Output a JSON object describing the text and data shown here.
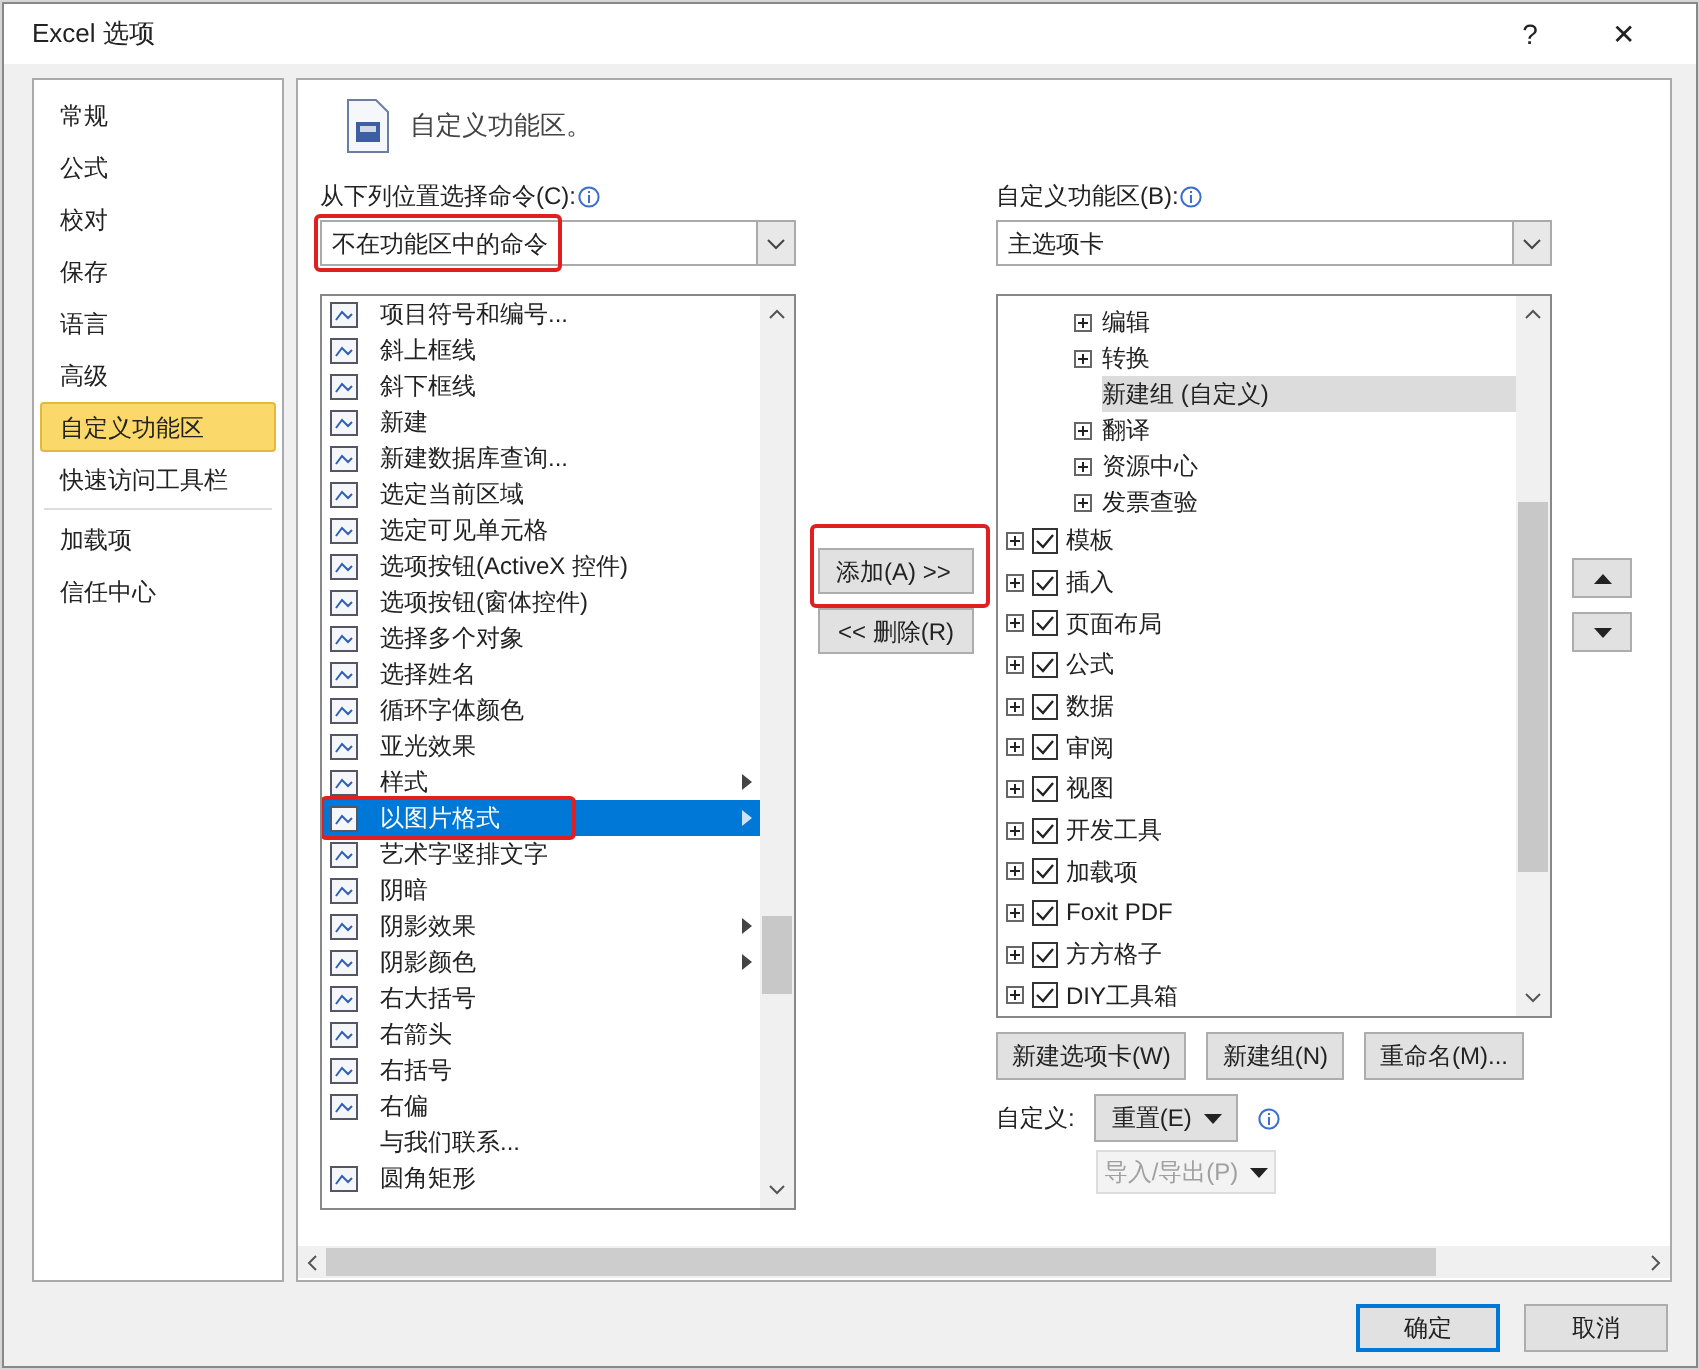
{
  "window": {
    "title": "Excel 选项",
    "help": "?",
    "close": "✕"
  },
  "sidebar": {
    "items": [
      {
        "label": "常规",
        "selected": false
      },
      {
        "label": "公式",
        "selected": false
      },
      {
        "label": "校对",
        "selected": false
      },
      {
        "label": "保存",
        "selected": false
      },
      {
        "label": "语言",
        "selected": false
      },
      {
        "label": "高级",
        "selected": false
      },
      {
        "label": "自定义功能区",
        "selected": true
      },
      {
        "label": "快速访问工具栏",
        "selected": false,
        "divider_after": true
      },
      {
        "label": "加载项",
        "selected": false
      },
      {
        "label": "信任中心",
        "selected": false
      }
    ]
  },
  "header": "自定义功能区。",
  "commands_source": {
    "label": "从下列位置选择命令(C):",
    "value": "不在功能区中的命令",
    "highlighted": true
  },
  "ribbon_target": {
    "label": "自定义功能区(B):",
    "value": "主选项卡"
  },
  "commands": [
    {
      "label": "项目符号和编号...",
      "has_icon": true,
      "submenu": false,
      "selected": false,
      "highlighted": false
    },
    {
      "label": "斜上框线",
      "has_icon": true,
      "submenu": false,
      "selected": false,
      "highlighted": false
    },
    {
      "label": "斜下框线",
      "has_icon": true,
      "submenu": false,
      "selected": false,
      "highlighted": false
    },
    {
      "label": "新建",
      "has_icon": true,
      "submenu": false,
      "selected": false,
      "highlighted": false
    },
    {
      "label": "新建数据库查询...",
      "has_icon": true,
      "submenu": false,
      "selected": false,
      "highlighted": false
    },
    {
      "label": "选定当前区域",
      "has_icon": true,
      "submenu": false,
      "selected": false,
      "highlighted": false
    },
    {
      "label": "选定可见单元格",
      "has_icon": true,
      "submenu": false,
      "selected": false,
      "highlighted": false
    },
    {
      "label": "选项按钮(ActiveX 控件)",
      "has_icon": true,
      "submenu": false,
      "selected": false,
      "highlighted": false
    },
    {
      "label": "选项按钮(窗体控件)",
      "has_icon": true,
      "submenu": false,
      "selected": false,
      "highlighted": false
    },
    {
      "label": "选择多个对象",
      "has_icon": true,
      "submenu": false,
      "selected": false,
      "highlighted": false
    },
    {
      "label": "选择姓名",
      "has_icon": true,
      "submenu": false,
      "selected": false,
      "highlighted": false
    },
    {
      "label": "循环字体颜色",
      "has_icon": true,
      "submenu": false,
      "selected": false,
      "highlighted": false
    },
    {
      "label": "亚光效果",
      "has_icon": true,
      "submenu": false,
      "selected": false,
      "highlighted": false
    },
    {
      "label": "样式",
      "has_icon": true,
      "submenu": true,
      "selected": false,
      "highlighted": false
    },
    {
      "label": "以图片格式",
      "has_icon": true,
      "submenu": true,
      "selected": true,
      "highlighted": true
    },
    {
      "label": "艺术字竖排文字",
      "has_icon": true,
      "submenu": false,
      "selected": false,
      "highlighted": false
    },
    {
      "label": "阴暗",
      "has_icon": true,
      "submenu": false,
      "selected": false,
      "highlighted": false
    },
    {
      "label": "阴影效果",
      "has_icon": true,
      "submenu": true,
      "selected": false,
      "highlighted": false
    },
    {
      "label": "阴影颜色",
      "has_icon": true,
      "submenu": true,
      "selected": false,
      "highlighted": false
    },
    {
      "label": "右大括号",
      "has_icon": true,
      "submenu": false,
      "selected": false,
      "highlighted": false
    },
    {
      "label": "右箭头",
      "has_icon": true,
      "submenu": false,
      "selected": false,
      "highlighted": false
    },
    {
      "label": "右括号",
      "has_icon": true,
      "submenu": false,
      "selected": false,
      "highlighted": false
    },
    {
      "label": "右偏",
      "has_icon": true,
      "submenu": false,
      "selected": false,
      "highlighted": false
    },
    {
      "label": "与我们联系...",
      "has_icon": false,
      "submenu": false,
      "selected": false,
      "highlighted": false
    },
    {
      "label": "圆角矩形",
      "has_icon": true,
      "submenu": false,
      "selected": false,
      "highlighted": false
    }
  ],
  "add_button": {
    "label": "添加(A) >>",
    "highlighted": true
  },
  "remove_button": {
    "label": "<< 删除(R)"
  },
  "tree": [
    {
      "label": "编辑",
      "kind": "group",
      "expanded": false,
      "selected": false
    },
    {
      "label": "转换",
      "kind": "group",
      "expanded": false,
      "selected": false
    },
    {
      "label": "新建组 (自定义)",
      "kind": "custom",
      "selected": true
    },
    {
      "label": "翻译",
      "kind": "group",
      "expanded": false,
      "selected": false
    },
    {
      "label": "资源中心",
      "kind": "group",
      "expanded": false,
      "selected": false
    },
    {
      "label": "发票查验",
      "kind": "group",
      "expanded": false,
      "selected": false
    },
    {
      "label": "模板",
      "kind": "tab",
      "expanded": false,
      "checked": true,
      "selected": false
    },
    {
      "label": "插入",
      "kind": "tab",
      "expanded": false,
      "checked": true,
      "selected": false
    },
    {
      "label": "页面布局",
      "kind": "tab",
      "expanded": false,
      "checked": true,
      "selected": false
    },
    {
      "label": "公式",
      "kind": "tab",
      "expanded": false,
      "checked": true,
      "selected": false
    },
    {
      "label": "数据",
      "kind": "tab",
      "expanded": false,
      "checked": true,
      "selected": false
    },
    {
      "label": "审阅",
      "kind": "tab",
      "expanded": false,
      "checked": true,
      "selected": false
    },
    {
      "label": "视图",
      "kind": "tab",
      "expanded": false,
      "checked": true,
      "selected": false
    },
    {
      "label": "开发工具",
      "kind": "tab",
      "expanded": false,
      "checked": true,
      "selected": false
    },
    {
      "label": "加载项",
      "kind": "tab",
      "expanded": false,
      "checked": true,
      "selected": false
    },
    {
      "label": "Foxit PDF",
      "kind": "tab",
      "expanded": false,
      "checked": true,
      "selected": false
    },
    {
      "label": "方方格子",
      "kind": "tab",
      "expanded": false,
      "checked": true,
      "selected": false
    },
    {
      "label": "DIY工具箱",
      "kind": "tab",
      "expanded": false,
      "checked": true,
      "selected": false
    }
  ],
  "tree_buttons": [
    "新建选项卡(W)",
    "新建组(N)",
    "重命名(M)..."
  ],
  "customize": {
    "label": "自定义:",
    "reset": "重置(E)",
    "import_export": "导入/导出(P)",
    "import_export_disabled": true
  },
  "footer": {
    "ok": "确定",
    "cancel": "取消"
  }
}
